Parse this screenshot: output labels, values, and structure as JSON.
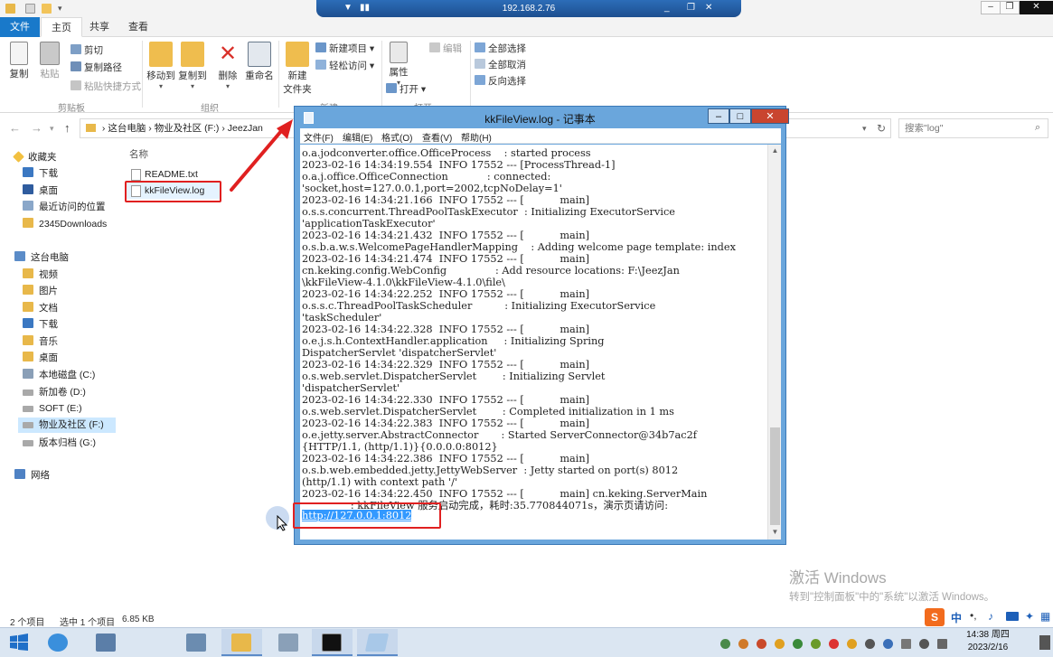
{
  "rdp": {
    "host": "192.168.2.76"
  },
  "explorer": {
    "tabs": [
      "文件",
      "主页",
      "共享",
      "查看"
    ],
    "ribbon": {
      "copy": "复制",
      "paste": "粘贴",
      "cut": "剪切",
      "copy_path": "复制路径",
      "paste_shortcut": "粘贴快捷方式",
      "clipboard_group": "剪贴板",
      "move_to": "移动到",
      "copy_to": "复制到",
      "delete": "删除",
      "rename": "重命名",
      "organize_group": "组织",
      "new_folder": "新建",
      "new_folder_2": "文件夹",
      "new_item": "新建项目",
      "easy_access": "轻松访问",
      "new_group": "新建",
      "properties": "属性",
      "open": "打开",
      "edit": "编辑",
      "open_group": "打开",
      "select_all": "全部选择",
      "select_none": "全部取消",
      "invert_selection": "反向选择"
    },
    "address": {
      "crumbs": [
        "这台电脑",
        "物业及社区 (F:)",
        "JeezJan"
      ],
      "search_placeholder": "搜索\"log\""
    },
    "nav": {
      "favorites": "收藏夹",
      "fav_items": [
        "下载",
        "桌面",
        "最近访问的位置",
        "2345Downloads"
      ],
      "this_pc": "这台电脑",
      "pc_items": [
        "视频",
        "图片",
        "文档",
        "下载",
        "音乐",
        "桌面",
        "本地磁盘 (C:)",
        "新加卷 (D:)",
        "SOFT (E:)",
        "物业及社区 (F:)",
        "版本归档 (G:)"
      ],
      "network": "网络"
    },
    "column_name": "名称",
    "files": [
      "README.txt",
      "kkFileView.log"
    ],
    "status": {
      "count": "2 个项目",
      "selected": "选中 1 个项目",
      "size": "6.85 KB"
    }
  },
  "notepad": {
    "title": "kkFileView.log - 记事本",
    "menu": [
      "文件(F)",
      "编辑(E)",
      "格式(O)",
      "查看(V)",
      "帮助(H)"
    ],
    "lines": [
      "o.a.jodconverter.office.OfficeProcess    : started process",
      "2023-02-16 14:34:19.554  INFO 17552 --- [ProcessThread-1]",
      "o.a.j.office.OfficeConnection            : connected:",
      "'socket,host=127.0.0.1,port=2002,tcpNoDelay=1'",
      "2023-02-16 14:34:21.166  INFO 17552 --- [           main]",
      "o.s.s.concurrent.ThreadPoolTaskExecutor  : Initializing ExecutorService",
      "'applicationTaskExecutor'",
      "2023-02-16 14:34:21.432  INFO 17552 --- [           main]",
      "o.s.b.a.w.s.WelcomePageHandlerMapping    : Adding welcome page template: index",
      "2023-02-16 14:34:21.474  INFO 17552 --- [           main]",
      "cn.keking.config.WebConfig               : Add resource locations: F:\\JeezJan",
      "\\kkFileView-4.1.0\\kkFileView-4.1.0\\file\\",
      "2023-02-16 14:34:22.252  INFO 17552 --- [           main]",
      "o.s.s.c.ThreadPoolTaskScheduler          : Initializing ExecutorService",
      "'taskScheduler'",
      "2023-02-16 14:34:22.328  INFO 17552 --- [           main]",
      "o.e.j.s.h.ContextHandler.application     : Initializing Spring",
      "DispatcherServlet 'dispatcherServlet'",
      "2023-02-16 14:34:22.329  INFO 17552 --- [           main]",
      "o.s.web.servlet.DispatcherServlet        : Initializing Servlet",
      "'dispatcherServlet'",
      "2023-02-16 14:34:22.330  INFO 17552 --- [           main]",
      "o.s.web.servlet.DispatcherServlet        : Completed initialization in 1 ms",
      "2023-02-16 14:34:22.383  INFO 17552 --- [           main]",
      "o.e.jetty.server.AbstractConnector       : Started ServerConnector@34b7ac2f",
      "{HTTP/1.1, (http/1.1)}{0.0.0.0:8012}",
      "2023-02-16 14:34:22.386  INFO 17552 --- [           main]",
      "o.s.b.web.embedded.jetty.JettyWebServer  : Jetty started on port(s) 8012",
      "(http/1.1) with context path '/'",
      "2023-02-16 14:34:22.450  INFO 17552 --- [           main] cn.keking.ServerMain",
      "               : kkFileView 服务启动完成，耗时:35.770844071s，演示页请访问:"
    ],
    "url": "http://127.0.0.1:8012"
  },
  "watermark": {
    "line1": "激活 Windows",
    "line2": "转到\"控制面板\"中的\"系统\"以激活 Windows。"
  },
  "taskbar": {
    "time": "14:38 周四",
    "date": "2023/2/16",
    "ime": "中"
  },
  "colors": {
    "accent": "#1979ca",
    "highlight_red": "#e02020",
    "selection_blue": "#3399ff"
  }
}
